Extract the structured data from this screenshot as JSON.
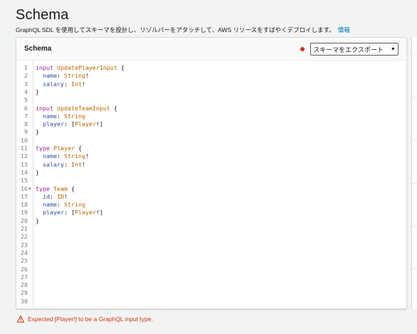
{
  "page": {
    "title": "Schema",
    "description": "GraphQL SDL を使用してスキーマを設計し、リゾルバーをアタッチして、AWS リソースをすばやくデプロイします。",
    "info_link": "情報"
  },
  "panel": {
    "title": "Schema",
    "export_button": "スキーマをエクスポート",
    "status_color": "#d13212"
  },
  "editor": {
    "lines": [
      [
        [
          "kw",
          "input"
        ],
        [
          "punct",
          " "
        ],
        [
          "tn",
          "UpdatePlayerInput"
        ],
        [
          "punct",
          " {"
        ]
      ],
      [
        [
          "punct",
          "  "
        ],
        [
          "field",
          "name"
        ],
        [
          "punct",
          ": "
        ],
        [
          "tn",
          "String"
        ],
        [
          "punct",
          "!"
        ]
      ],
      [
        [
          "punct",
          "  "
        ],
        [
          "field",
          "salary"
        ],
        [
          "punct",
          ": "
        ],
        [
          "tn",
          "Int"
        ],
        [
          "punct",
          "!"
        ]
      ],
      [
        [
          "punct",
          "}"
        ]
      ],
      [],
      [
        [
          "kw",
          "input"
        ],
        [
          "punct",
          " "
        ],
        [
          "tn",
          "UpdateTeamInput"
        ],
        [
          "punct",
          " {"
        ]
      ],
      [
        [
          "punct",
          "  "
        ],
        [
          "field",
          "name"
        ],
        [
          "punct",
          ": "
        ],
        [
          "tn",
          "String"
        ]
      ],
      [
        [
          "punct",
          "  "
        ],
        [
          "field",
          "player"
        ],
        [
          "punct",
          ": ["
        ],
        [
          "tn",
          "Player"
        ],
        [
          "punct",
          "!]"
        ]
      ],
      [
        [
          "punct",
          "}"
        ]
      ],
      [],
      [
        [
          "kw",
          "type"
        ],
        [
          "punct",
          " "
        ],
        [
          "tn",
          "Player"
        ],
        [
          "punct",
          " {"
        ]
      ],
      [
        [
          "punct",
          "  "
        ],
        [
          "field",
          "name"
        ],
        [
          "punct",
          ": "
        ],
        [
          "tn",
          "String"
        ],
        [
          "punct",
          "!"
        ]
      ],
      [
        [
          "punct",
          "  "
        ],
        [
          "field",
          "salary"
        ],
        [
          "punct",
          ": "
        ],
        [
          "tn",
          "Int"
        ],
        [
          "punct",
          "!"
        ]
      ],
      [
        [
          "punct",
          "}"
        ]
      ],
      [],
      [
        [
          "kw",
          "type"
        ],
        [
          "punct",
          " "
        ],
        [
          "tn",
          "Team"
        ],
        [
          "punct",
          " {"
        ]
      ],
      [
        [
          "punct",
          "  "
        ],
        [
          "field",
          "id"
        ],
        [
          "punct",
          ": "
        ],
        [
          "tn",
          "ID"
        ],
        [
          "punct",
          "!"
        ]
      ],
      [
        [
          "punct",
          "  "
        ],
        [
          "field",
          "name"
        ],
        [
          "punct",
          ": "
        ],
        [
          "tn",
          "String"
        ]
      ],
      [
        [
          "punct",
          "  "
        ],
        [
          "field",
          "player"
        ],
        [
          "punct",
          ": ["
        ],
        [
          "tn",
          "Player"
        ],
        [
          "punct",
          "!]"
        ]
      ],
      [
        [
          "punct",
          "}"
        ]
      ],
      [],
      [],
      [],
      [],
      [],
      [],
      [],
      [],
      [],
      []
    ],
    "fold_markers": [
      16
    ]
  },
  "error": {
    "icon": "warning-icon",
    "message": "Expected [Player!] to be a GraphQL input type.",
    "color": "#d13212"
  }
}
